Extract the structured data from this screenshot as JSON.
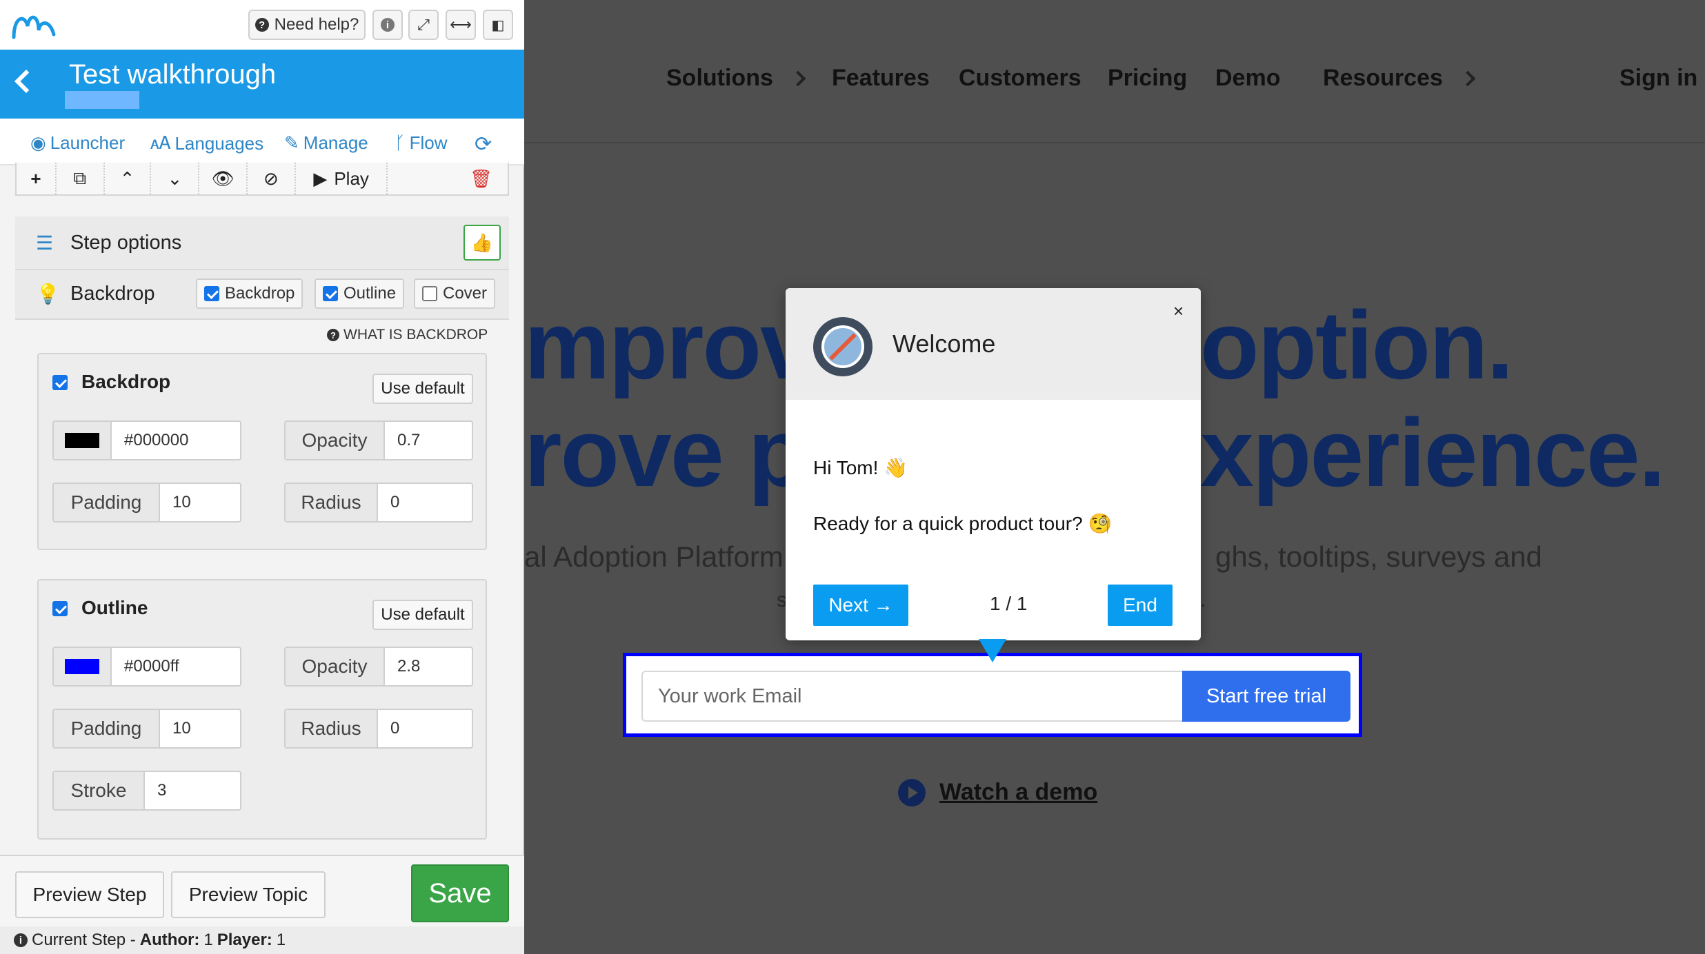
{
  "panel": {
    "help_label": "Need help?",
    "title": "Test walkthrough",
    "tabs": [
      {
        "label": "Launcher",
        "icon": "target-icon"
      },
      {
        "label": "Languages",
        "icon": "translate-icon"
      },
      {
        "label": "Manage",
        "icon": "pencil-icon"
      },
      {
        "label": "Flow",
        "icon": "branch-icon"
      }
    ],
    "toolbar": {
      "play_label": "Play"
    },
    "step_options_label": "Step options",
    "backdrop_row": {
      "label": "Backdrop",
      "options": [
        {
          "label": "Backdrop",
          "checked": true
        },
        {
          "label": "Outline",
          "checked": true
        },
        {
          "label": "Cover",
          "checked": false
        }
      ],
      "what_is_label": "WHAT IS BACKDROP"
    },
    "backdrop_card": {
      "title": "Backdrop",
      "checked": true,
      "use_default": "Use default",
      "color_value": "#000000",
      "color_swatch": "#000000",
      "opacity_label": "Opacity",
      "opacity_value": "0.7",
      "padding_label": "Padding",
      "padding_value": "10",
      "radius_label": "Radius",
      "radius_value": "0"
    },
    "outline_card": {
      "title": "Outline",
      "checked": true,
      "use_default": "Use default",
      "color_value": "#0000ff",
      "color_swatch": "#0000ff",
      "opacity_label": "Opacity",
      "opacity_value": "2.8",
      "padding_label": "Padding",
      "padding_value": "10",
      "radius_label": "Radius",
      "radius_value": "0",
      "stroke_label": "Stroke",
      "stroke_value": "3"
    },
    "footer": {
      "preview_step": "Preview Step",
      "preview_topic": "Preview Topic",
      "save": "Save"
    },
    "status": {
      "prefix": "Current Step - ",
      "author_label": "Author:",
      "author_value": "1",
      "player_label": "Player:",
      "player_value": "1"
    }
  },
  "site": {
    "nav": [
      {
        "label": "Solutions",
        "chevron": true
      },
      {
        "label": "Features",
        "chevron": false
      },
      {
        "label": "Customers",
        "chevron": false
      },
      {
        "label": "Pricing",
        "chevron": false
      },
      {
        "label": "Demo",
        "chevron": false
      },
      {
        "label": "Resources",
        "chevron": true
      }
    ],
    "signin": "Sign in",
    "hero_line1_left": "mprov",
    "hero_line1_right": "option.",
    "hero_line2_left": "rove p",
    "hero_line2_right": "xperience.",
    "sub_left": "al Adoption Platform",
    "sub_right": "ghs, tooltips, surveys and",
    "sub2_left": "s",
    "sub2_right": ".",
    "email_placeholder": "Your work Email",
    "trial_label": "Start free trial",
    "watch_demo": "Watch a demo"
  },
  "popup": {
    "title": "Welcome",
    "close": "×",
    "line1": "Hi Tom! 👋",
    "line2": "Ready for a quick product tour? 🧐",
    "next": "Next →",
    "counter": "1 / 1",
    "end": "End"
  },
  "colors": {
    "accent": "#1a9ae6",
    "save_green": "#3aa547",
    "popup_button": "#0a9cf0",
    "outline_blue": "#0000ff",
    "hero_navy": "#0f2a62"
  }
}
